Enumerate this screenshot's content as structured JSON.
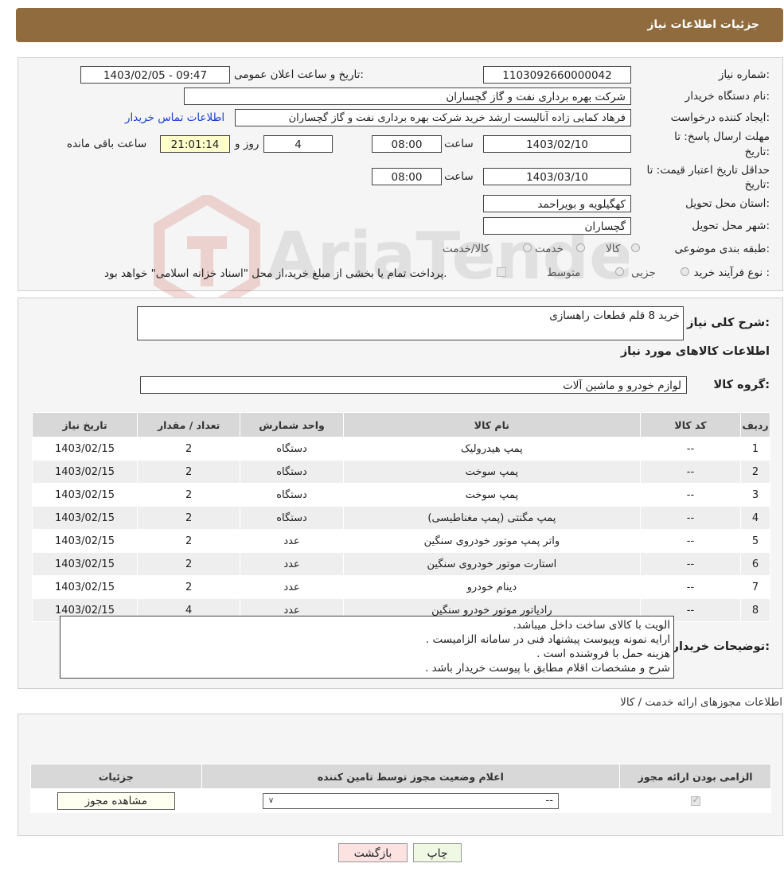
{
  "header": {
    "title": "جزئیات اطلاعات نیاز"
  },
  "form": {
    "need_number_label": "شماره نیاز:",
    "need_number": "1103092660000042",
    "announce_label": "تاریخ و ساعت اعلان عمومی:",
    "announce_value": "1403/02/05 - 09:47",
    "buyer_org_label": "نام دستگاه خریدار:",
    "buyer_org": "شرکت بهره برداری نفت و گاز گچساران",
    "creator_label": "ایجاد کننده درخواست:",
    "creator": "فرهاد کمایی زاده آنالیست ارشد خرید شرکت بهره برداری نفت و گاز گچساران",
    "contact_link": "اطلاعات تماس خریدار",
    "deadline_label_1": "مهلت ارسال پاسخ: تا",
    "deadline_label_2": "تاریخ:",
    "deadline_date": "1403/02/10",
    "time_label": "ساعت",
    "deadline_time": "08:00",
    "days_value": "4",
    "days_label": "روز و",
    "remaining_time": "21:01:14",
    "remaining_label": "ساعت باقی مانده",
    "validity_label_1": "حداقل تاریخ اعتبار قیمت: تا",
    "validity_label_2": "تاریخ:",
    "validity_date": "1403/03/10",
    "validity_time": "08:00",
    "province_label": "استان محل تحویل:",
    "province": "کهگیلویه و بویراحمد",
    "city_label": "شهر محل تحویل:",
    "city": "گچساران",
    "category_label": "طبقه بندی موضوعی:",
    "category_options": [
      "کالا",
      "خدمت",
      "کالا/خدمت"
    ],
    "process_label": "نوع فرآیند خرید :",
    "process_options": [
      "جزیی",
      "متوسط"
    ],
    "payment_note": "پرداخت تمام یا بخشی از مبلغ خرید،از محل \"اسناد خزانه اسلامی\" خواهد بود."
  },
  "description": {
    "label": "شرح کلی نیاز:",
    "value": "خرید 8 قلم قطعات راهسازی"
  },
  "goods": {
    "section_title": "اطلاعات کالاهای مورد نیاز",
    "group_label": "گروه کالا:",
    "group_value": "لوازم خودرو و ماشین آلات",
    "columns": [
      "ردیف",
      "کد کالا",
      "نام کالا",
      "واحد شمارش",
      "تعداد / مقدار",
      "تاریخ نیاز"
    ],
    "rows": [
      [
        "1",
        "--",
        "پمپ هیدرولیک",
        "دستگاه",
        "2",
        "1403/02/15"
      ],
      [
        "2",
        "--",
        "پمپ سوخت",
        "دستگاه",
        "2",
        "1403/02/15"
      ],
      [
        "3",
        "--",
        "پمپ سوخت",
        "دستگاه",
        "2",
        "1403/02/15"
      ],
      [
        "4",
        "--",
        "پمپ مگنتی (پمپ مغناطیسی)",
        "دستگاه",
        "2",
        "1403/02/15"
      ],
      [
        "5",
        "--",
        "واتر پمپ موتور خودروی سنگین",
        "عدد",
        "2",
        "1403/02/15"
      ],
      [
        "6",
        "--",
        "استارت موتور خودروی سنگین",
        "عدد",
        "2",
        "1403/02/15"
      ],
      [
        "7",
        "--",
        "دینام خودرو",
        "عدد",
        "2",
        "1403/02/15"
      ],
      [
        "8",
        "--",
        "رادیاتور موتور خودرو سنگین",
        "عدد",
        "4",
        "1403/02/15"
      ]
    ]
  },
  "buyer_notes": {
    "label": "توضیحات خریدار:",
    "lines": [
      "الویت با کالای ساخت داخل میباشد.",
      "ارایه نمونه وپیوست پیشنهاد فنی در سامانه الزامیست .",
      "هزینه حمل با فروشنده است .",
      "شرح و مشخصات اقلام مطابق با پیوست خریدار باشد ."
    ]
  },
  "permits": {
    "section_title": "اطلاعات مجوزهای ارائه خدمت / کالا",
    "columns": [
      "الزامی بودن ارائه مجوز",
      "اعلام وضعیت مجوز توسط تامین کننده",
      "جزئیات"
    ],
    "select_value": "--",
    "view_button": "مشاهده مجوز"
  },
  "footer": {
    "print_button": "چاپ",
    "back_button": "بازگشت"
  },
  "watermark": {
    "text": "AriaTender.neT"
  }
}
